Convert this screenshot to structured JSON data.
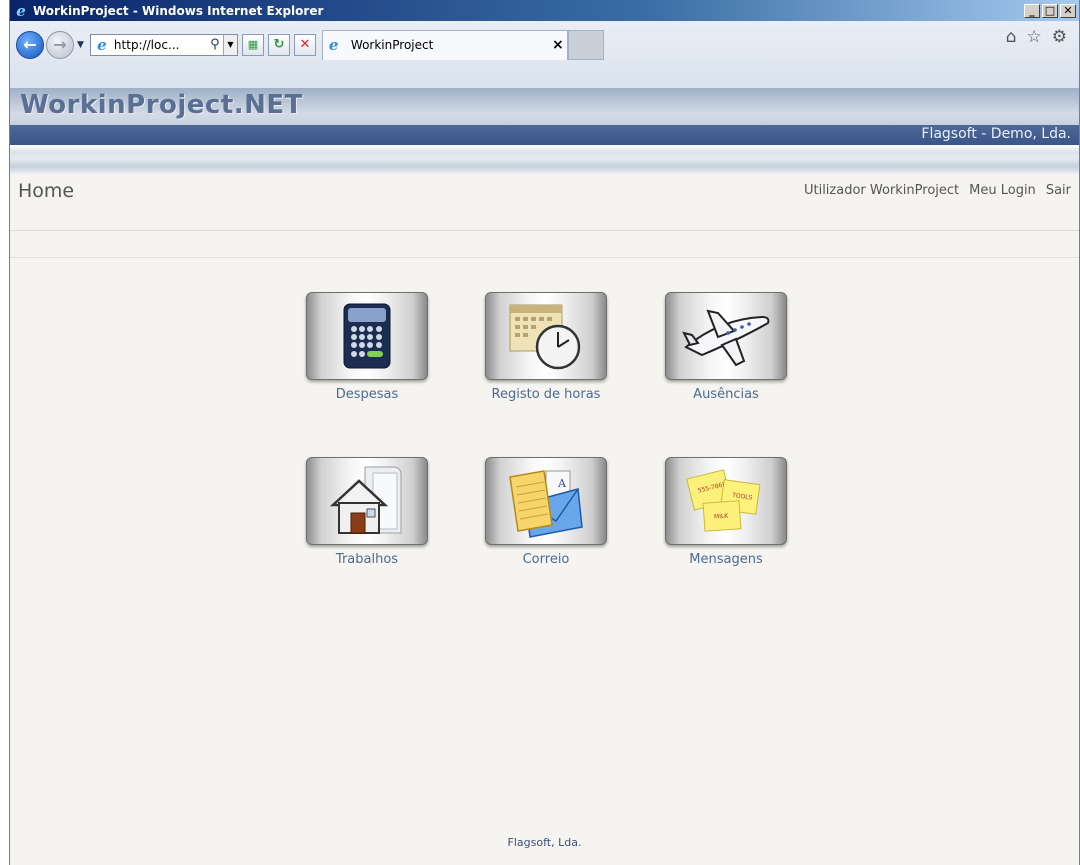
{
  "window": {
    "title": "WorkinProject - Windows Internet Explorer",
    "controls": {
      "minimize": "_",
      "maximize": "□",
      "close": "✕"
    }
  },
  "browser": {
    "address": "http://loc...",
    "tab_title": "WorkinProject",
    "tab_close": "×",
    "icons": [
      "home-icon",
      "favorites-star-icon",
      "tools-gear-icon"
    ]
  },
  "app": {
    "brand": "WorkinProject.NET",
    "company": "Flagsoft - Demo, Lda."
  },
  "page": {
    "title": "Home",
    "user": "Utilizador WorkinProject",
    "my_login": "Meu Login",
    "logout": "Sair"
  },
  "tiles": [
    {
      "label": "Despesas",
      "icon": "calculator-icon"
    },
    {
      "label": "Registo de horas",
      "icon": "calendar-clock-icon"
    },
    {
      "label": "Ausências",
      "icon": "airplane-icon"
    },
    {
      "label": "Trabalhos",
      "icon": "house-folder-icon"
    },
    {
      "label": "Correio",
      "icon": "mail-envelope-icon"
    },
    {
      "label": "Mensagens",
      "icon": "sticky-notes-icon"
    }
  ],
  "footer": "Flagsoft, Lda."
}
